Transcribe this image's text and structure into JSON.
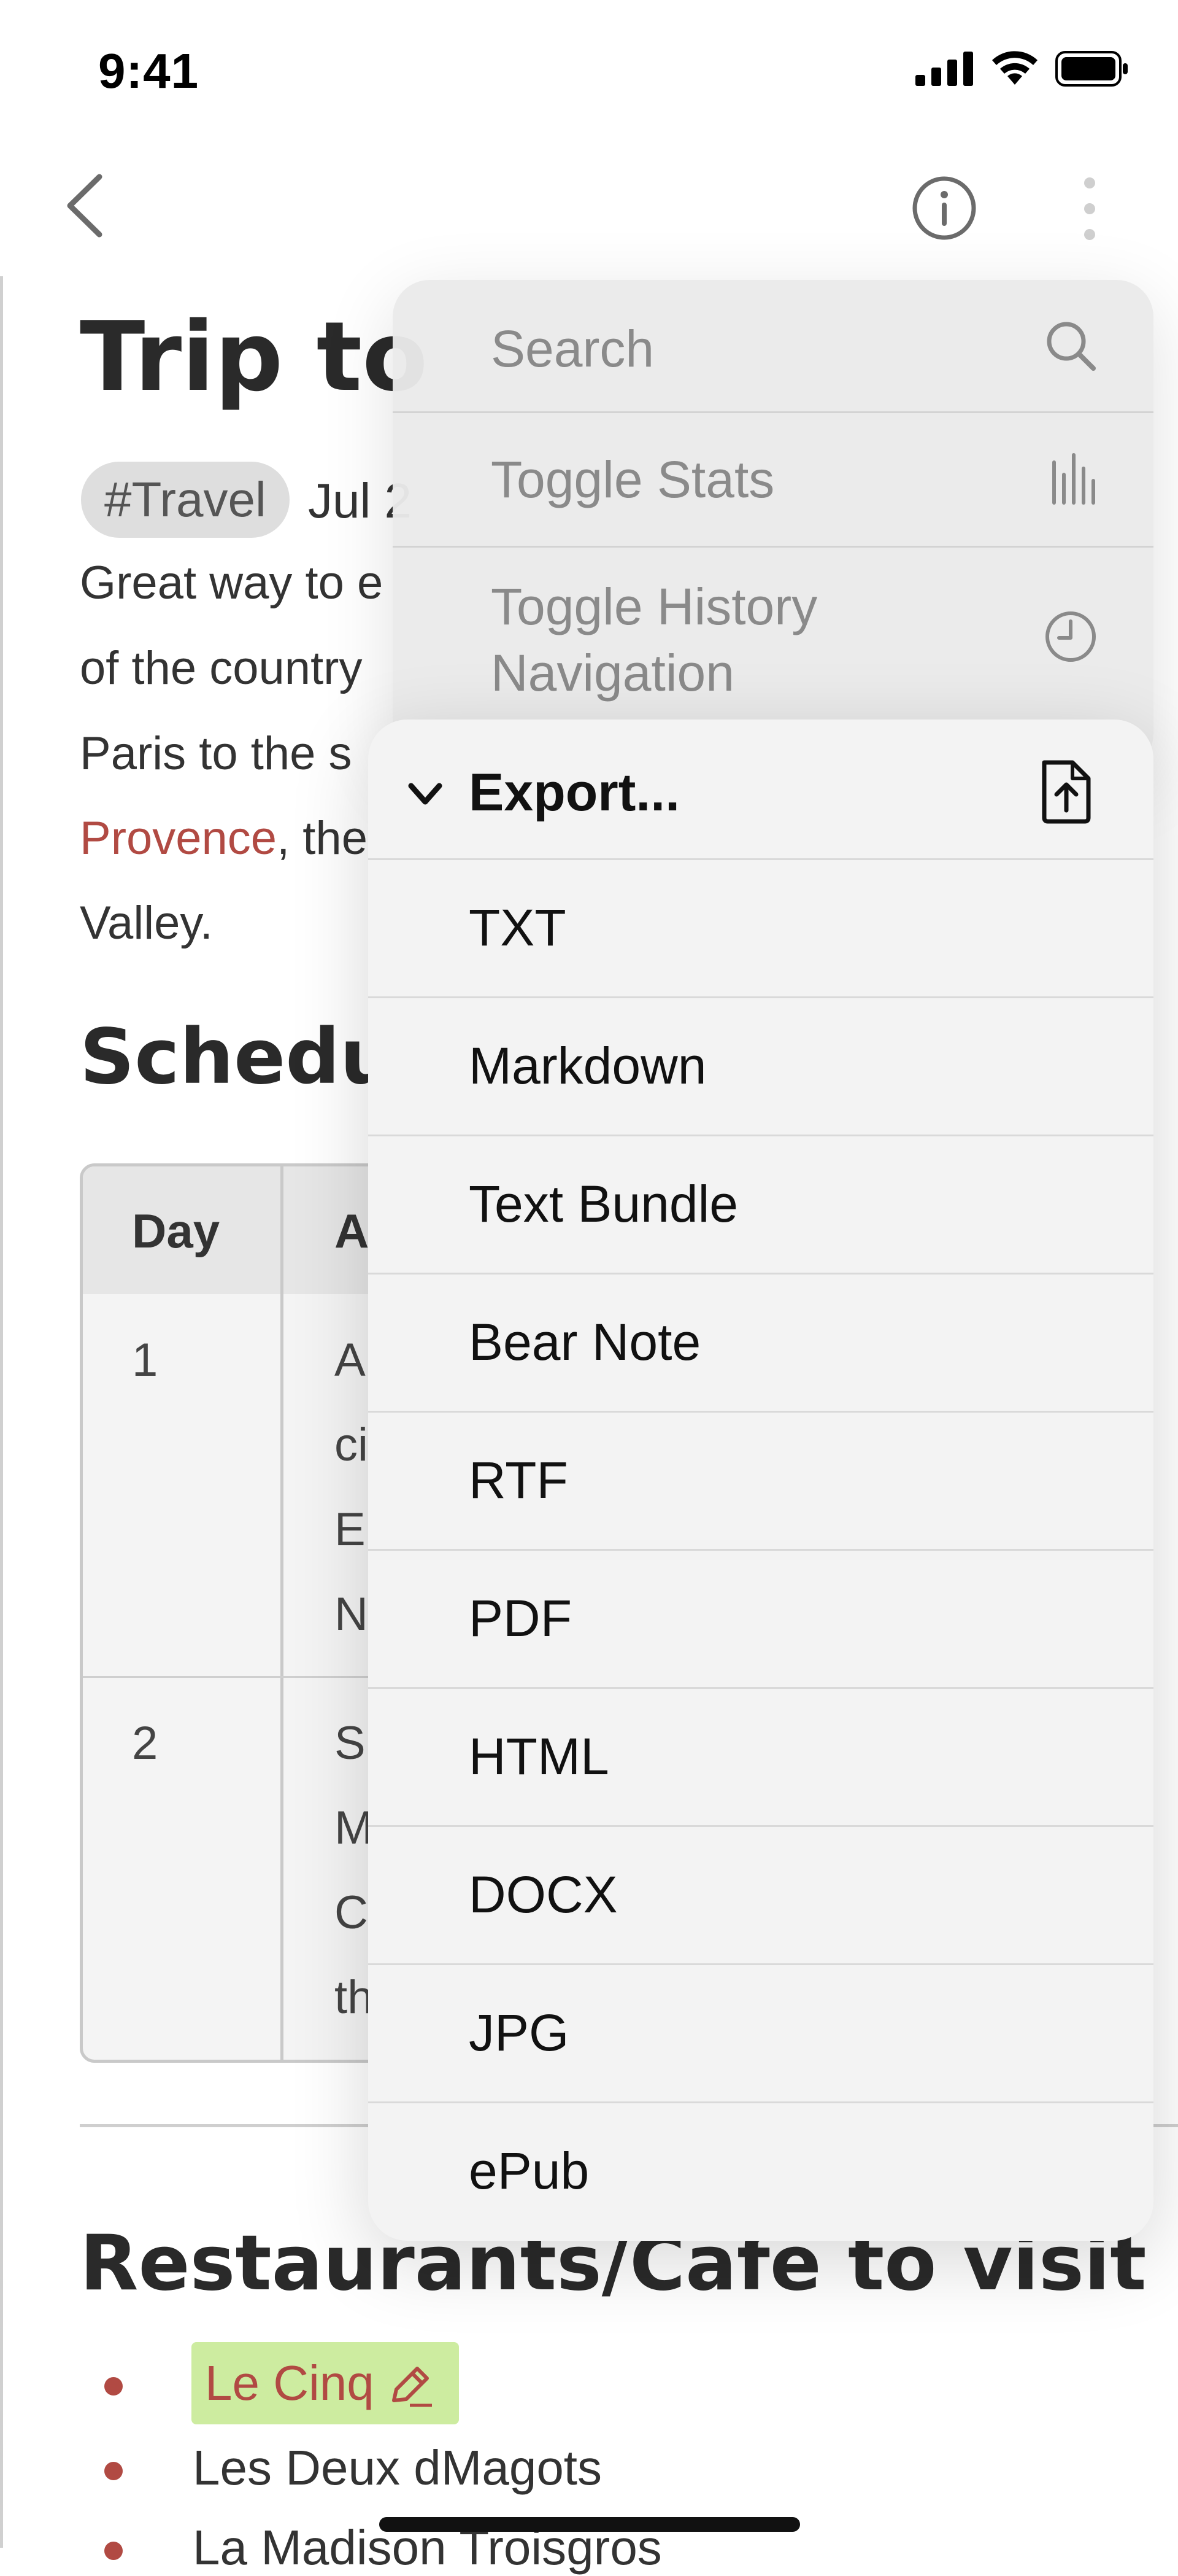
{
  "status_bar": {
    "time": "9:41"
  },
  "note": {
    "title": "Trip to",
    "tag": "#Travel",
    "date_fragment": "Jul 2",
    "paragraph_lines": [
      [
        "Great way to e",
        ""
      ],
      [
        "of the country",
        ""
      ],
      [
        "Paris to the s",
        ""
      ]
    ],
    "paragraph_link": "Provence",
    "paragraph_after_link": ", the",
    "paragraph_last": "Valley.",
    "schedule_heading": "Schedul",
    "table": {
      "header_day": "Day",
      "header_activity": "A",
      "rows": [
        {
          "day": "1",
          "lines": [
            "A",
            "ci",
            "E",
            "N"
          ]
        },
        {
          "day": "2",
          "lines": [
            "S",
            "M",
            "C",
            "th"
          ]
        }
      ]
    },
    "restaurants_heading": "Restaurants/Cafe to visit",
    "restaurants": [
      "Le Cinq",
      "Les Deux dMagots",
      "La Madison Troisgros"
    ]
  },
  "menu": {
    "items": [
      {
        "label": "Search",
        "icon": "search-icon"
      },
      {
        "label": "Toggle Stats",
        "icon": "stats-icon"
      },
      {
        "label_line1": "Toggle History",
        "label_line2": "Navigation",
        "icon": "history-icon"
      }
    ]
  },
  "export_menu": {
    "title": "Export...",
    "icon": "export-document-icon",
    "formats": [
      "TXT",
      "Markdown",
      "Text Bundle",
      "Bear Note",
      "RTF",
      "PDF",
      "HTML",
      "DOCX",
      "JPG",
      "ePub"
    ]
  },
  "colors": {
    "link": "#b14a43",
    "highlight": "#cdeca0",
    "tag_bg": "#dedede"
  }
}
